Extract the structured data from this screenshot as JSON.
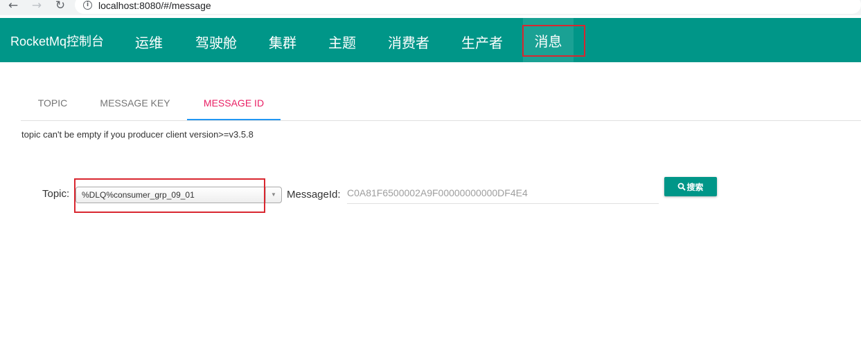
{
  "browser": {
    "url": "localhost:8080/#/message"
  },
  "navbar": {
    "brand": "RocketMq控制台",
    "items": [
      {
        "label": "运维"
      },
      {
        "label": "驾驶舱"
      },
      {
        "label": "集群"
      },
      {
        "label": "主题"
      },
      {
        "label": "消费者"
      },
      {
        "label": "生产者"
      },
      {
        "label": "消息",
        "active": true
      }
    ],
    "bg_color": "#009688"
  },
  "tabs": [
    {
      "label": "TOPIC"
    },
    {
      "label": "MESSAGE KEY"
    },
    {
      "label": "MESSAGE ID",
      "active": true
    }
  ],
  "hint": "topic can't be empty if you producer client version>=v3.5.8",
  "form": {
    "topic_label": "Topic:",
    "topic_value": "%DLQ%consumer_grp_09_01",
    "msgid_label": "MessageId:",
    "msgid_value": "C0A81F6500002A9F00000000000DF4E4",
    "search_label": "搜索"
  },
  "colors": {
    "accent": "#009688",
    "active_tab": "#e91e63",
    "highlight": "#d9262f"
  }
}
